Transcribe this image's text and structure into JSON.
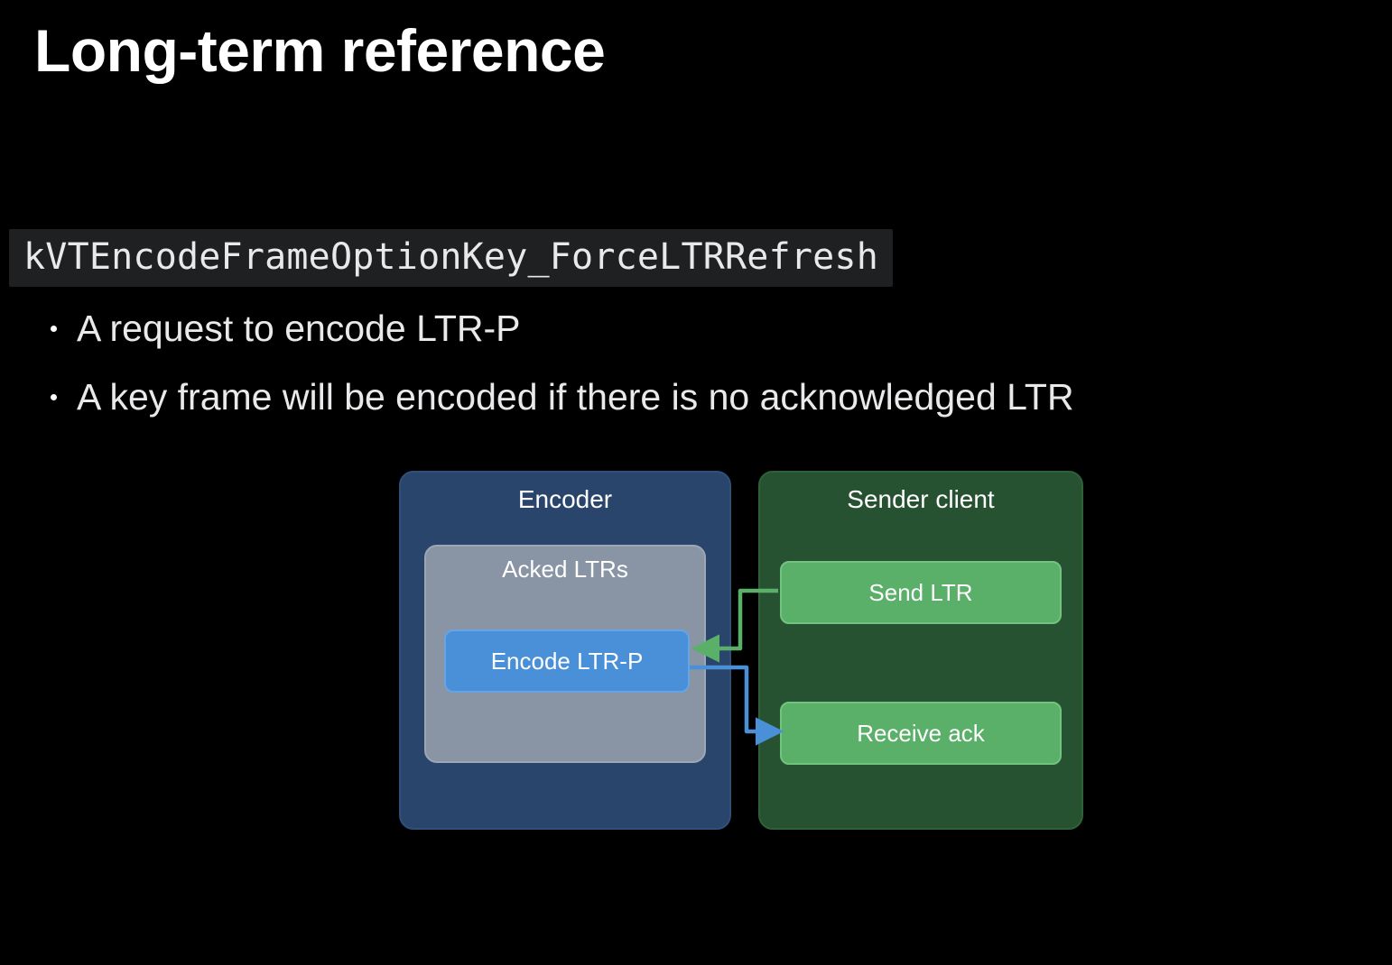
{
  "title": "Long-term reference",
  "code_key": "kVTEncodeFrameOptionKey_ForceLTRRefresh",
  "bullets": [
    "A request to encode LTR-P",
    "A key frame will be encoded if there is no acknowledged LTR"
  ],
  "diagram": {
    "encoder": {
      "label": "Encoder",
      "acked_label": "Acked LTRs",
      "encode_box": "Encode LTR-P"
    },
    "sender": {
      "label": "Sender client",
      "send_box": "Send LTR",
      "receive_box": "Receive ack"
    },
    "arrows": {
      "green_color": "#5aaf69",
      "blue_color": "#4a90d9"
    }
  }
}
